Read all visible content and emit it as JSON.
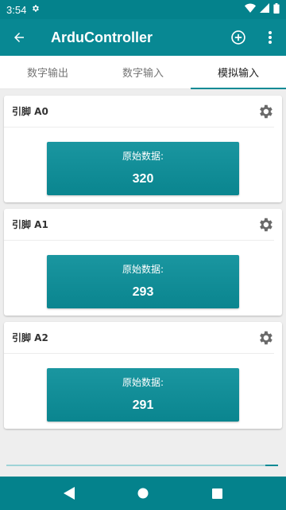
{
  "status_bar": {
    "time": "3:54"
  },
  "app_bar": {
    "title": "ArduController"
  },
  "tabs": [
    {
      "label": "数字输出",
      "active": false
    },
    {
      "label": "数字输入",
      "active": false
    },
    {
      "label": "模拟输入",
      "active": true
    }
  ],
  "pins": [
    {
      "label": "引脚 A0",
      "raw_label": "原始数据:",
      "value": "320"
    },
    {
      "label": "引脚 A1",
      "raw_label": "原始数据:",
      "value": "293"
    },
    {
      "label": "引脚 A2",
      "raw_label": "原始数据:",
      "value": "291"
    }
  ],
  "colors": {
    "primary": "#088893",
    "primary_dark": "#04828c",
    "accent": "#0a8a95",
    "background": "#eeeeee"
  },
  "icons": [
    "back-arrow-icon",
    "add-circle-icon",
    "more-vert-icon",
    "gear-icon",
    "wifi-icon",
    "signal-icon",
    "battery-icon",
    "nav-back-icon",
    "nav-home-icon",
    "nav-recents-icon"
  ]
}
